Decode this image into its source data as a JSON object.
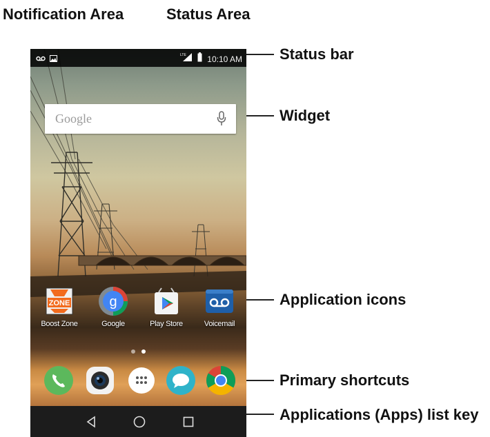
{
  "callouts": {
    "notification_area": "Notification Area",
    "status_area": "Status Area",
    "status_bar": "Status bar",
    "widget": "Widget",
    "application_icons": "Application icons",
    "primary_shortcuts": "Primary shortcuts",
    "apps_list_key": "Applications (Apps) list key"
  },
  "status_bar": {
    "time": "10:10 AM",
    "notification_icons": [
      "voicemail-icon",
      "image-icon"
    ],
    "status_icons": [
      "lte-icon",
      "signal-icon",
      "battery-icon"
    ]
  },
  "widget": {
    "label": "Google",
    "icon": "mic-icon"
  },
  "apps": [
    {
      "label": "Boost Zone",
      "icon": "boost-zone-icon",
      "icon_text": "ZONE"
    },
    {
      "label": "Google",
      "icon": "google-icon",
      "icon_text": "g"
    },
    {
      "label": "Play Store",
      "icon": "play-store-icon"
    },
    {
      "label": "Voicemail",
      "icon": "voicemail-icon"
    }
  ],
  "page_indicator": {
    "pages": 2,
    "active": 2
  },
  "dock": [
    "phone-icon",
    "camera-icon",
    "apps-list-icon",
    "messaging-icon",
    "chrome-icon"
  ],
  "navigation": [
    "back-icon",
    "home-icon",
    "recents-icon"
  ],
  "colors": {
    "phone": "#5cb85c",
    "messaging": "#2fb3c9",
    "voicemail": "#1f5fa8",
    "chrome_red": "#db4437",
    "chrome_yellow": "#f4b400",
    "chrome_green": "#0f9d58",
    "chrome_blue": "#4285f4"
  }
}
